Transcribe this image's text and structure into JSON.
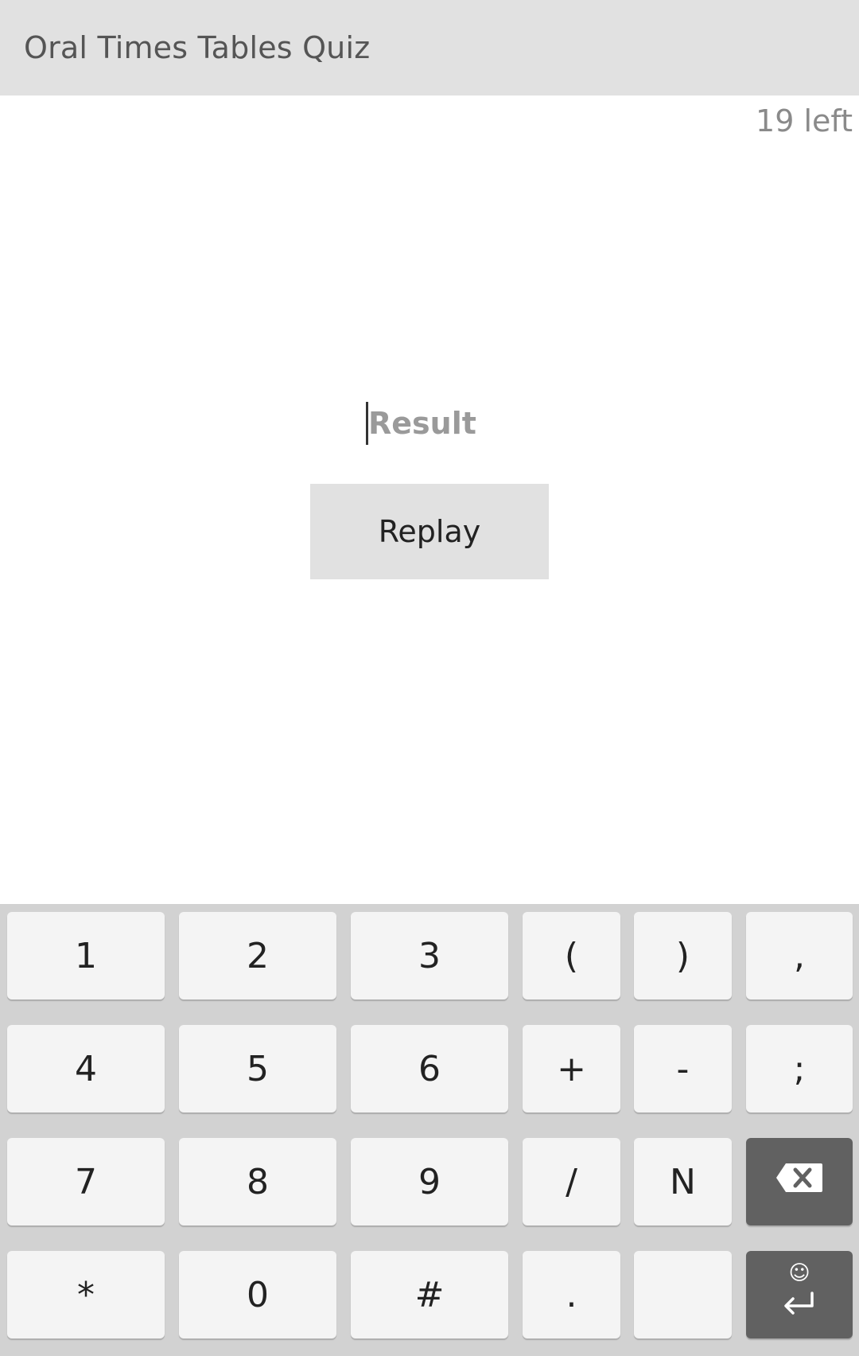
{
  "titlebar": {
    "title": "Oral Times Tables Quiz"
  },
  "quiz": {
    "remaining": "19 left",
    "result_placeholder": "Result",
    "replay_label": "Replay"
  },
  "keyboard": {
    "rows": [
      [
        "1",
        "2",
        "3",
        "(",
        ")",
        ","
      ],
      [
        "4",
        "5",
        "6",
        "+",
        "-",
        ";"
      ],
      [
        "7",
        "8",
        "9",
        "/",
        "N"
      ],
      [
        "*",
        "0",
        "#",
        ".",
        ""
      ]
    ],
    "backspace_icon": "backspace-icon",
    "enter_icon": "enter-icon",
    "emoji_icon": "smiley-icon"
  },
  "colors": {
    "titlebar_bg": "#e1e1e1",
    "keyboard_bg": "#d2d2d2",
    "key_bg": "#f4f4f4",
    "action_key_bg": "#616161"
  }
}
